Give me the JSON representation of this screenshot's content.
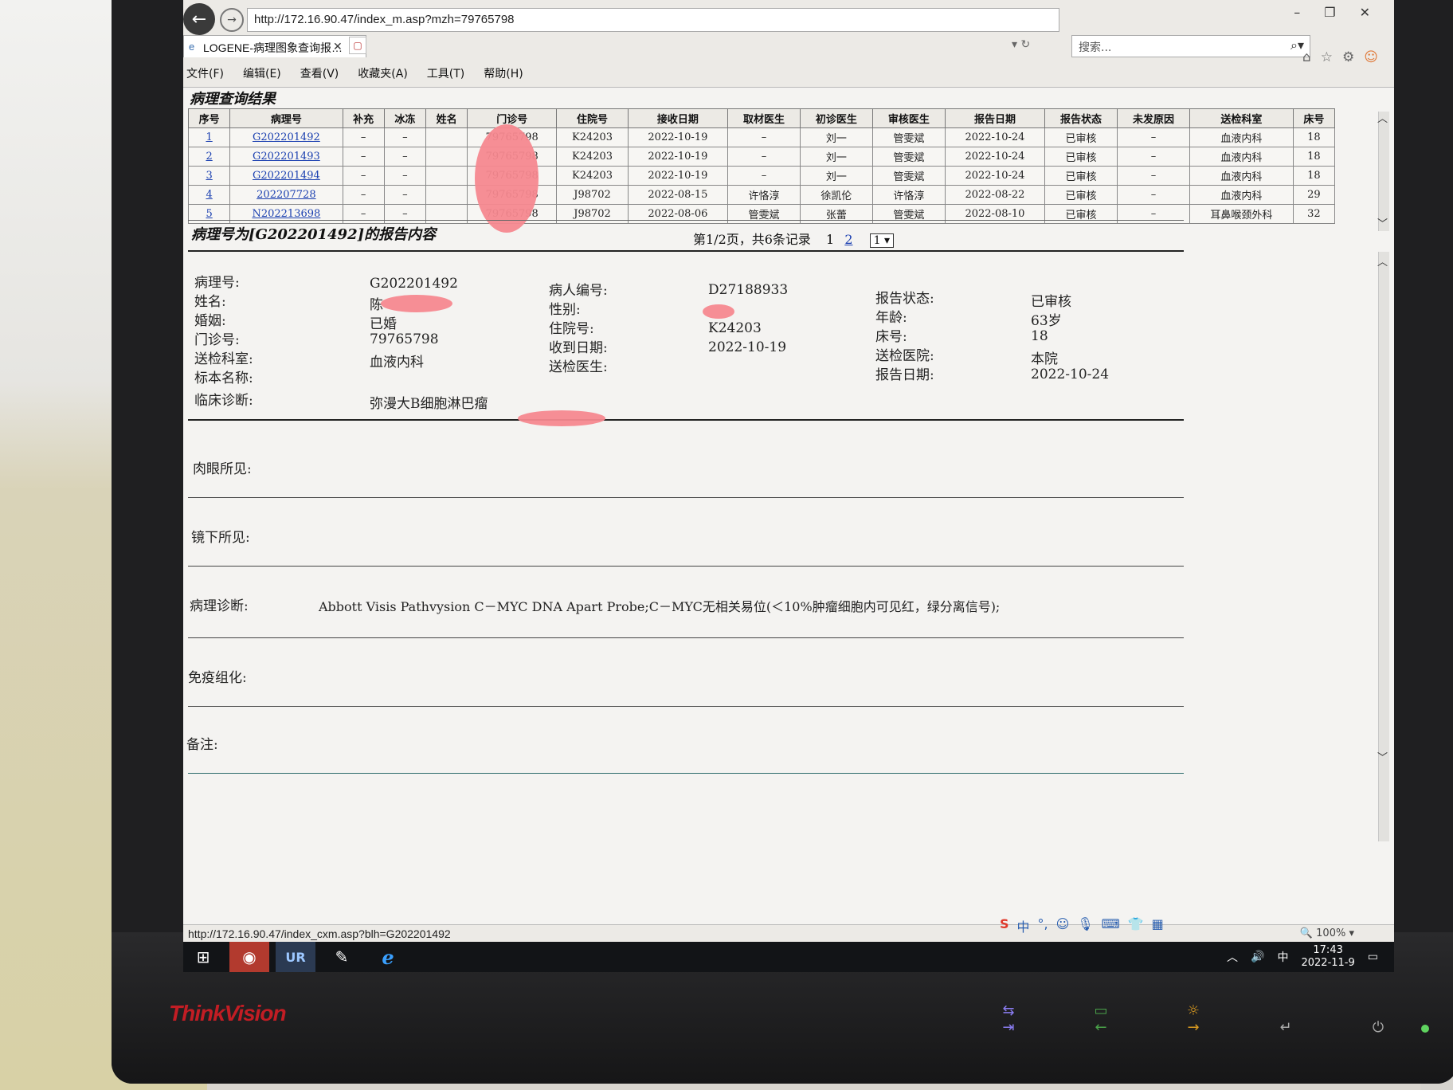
{
  "browser": {
    "url": "http://172.16.90.47/index_m.asp?mzh=79765798",
    "tab_title": "LOGENE-病理图象查询报…",
    "search_placeholder": "搜索...",
    "menu": [
      "文件(F)",
      "编辑(E)",
      "查看(V)",
      "收藏夹(A)",
      "工具(T)",
      "帮助(H)"
    ],
    "status_url": "http://172.16.90.47/index_cxm.asp?blh=G202201492",
    "zoom": "100%"
  },
  "results": {
    "title": "病理查询结果",
    "headers": [
      "序号",
      "病理号",
      "补充",
      "冰冻",
      "姓名",
      "门诊号",
      "住院号",
      "接收日期",
      "取材医生",
      "初诊医生",
      "审核医生",
      "报告日期",
      "报告状态",
      "未发原因",
      "送检科室",
      "床号"
    ],
    "rows": [
      [
        "1",
        "G202201492",
        "–",
        "–",
        "",
        "79765798",
        "K24203",
        "2022-10-19",
        "–",
        "刘一",
        "管雯斌",
        "2022-10-24",
        "已审核",
        "–",
        "血液内科",
        "18"
      ],
      [
        "2",
        "G202201493",
        "–",
        "–",
        "",
        "79765798",
        "K24203",
        "2022-10-19",
        "–",
        "刘一",
        "管雯斌",
        "2022-10-24",
        "已审核",
        "–",
        "血液内科",
        "18"
      ],
      [
        "3",
        "G202201494",
        "–",
        "–",
        "",
        "79765798",
        "K24203",
        "2022-10-19",
        "–",
        "刘一",
        "管雯斌",
        "2022-10-24",
        "已审核",
        "–",
        "血液内科",
        "18"
      ],
      [
        "4",
        "202207728",
        "–",
        "–",
        "",
        "79765798",
        "J98702",
        "2022-08-15",
        "许恪淳",
        "徐凯伦",
        "许恪淳",
        "2022-08-22",
        "已审核",
        "–",
        "血液内科",
        "29"
      ],
      [
        "5",
        "N202213698",
        "–",
        "–",
        "",
        "79765798",
        "J98702",
        "2022-08-06",
        "管雯斌",
        "张蕾",
        "管雯斌",
        "2022-08-10",
        "已审核",
        "–",
        "耳鼻喉颈外科",
        "32"
      ]
    ],
    "pager_text": "第1/2页，共6条记录",
    "page_current": "1",
    "page_next": "2",
    "page_select": "1"
  },
  "report": {
    "title": "病理号为[G202201492]的报告内容",
    "fields": {
      "blh_label": "病理号:",
      "blh_value": "G202201492",
      "name_label": "姓名:",
      "name_value": "陈",
      "marital_label": "婚姻:",
      "marital_value": "已婚",
      "outpatient_label": "门诊号:",
      "outpatient_value": "79765798",
      "dept_label": "送检科室:",
      "dept_value": "血液内科",
      "specimen_label": "标本名称:",
      "specimen_value": "",
      "clinical_label": "临床诊断:",
      "clinical_value": "弥漫大B细胞淋巴瘤",
      "patient_id_label": "病人编号:",
      "patient_id_value": "D27188933",
      "sex_label": "性别:",
      "sex_value": "",
      "inpatient_label": "住院号:",
      "inpatient_value": "K24203",
      "received_label": "收到日期:",
      "received_value": "2022-10-19",
      "doctor_label": "送检医生:",
      "doctor_value": "",
      "status_label": "报告状态:",
      "status_value": "已审核",
      "age_label": "年龄:",
      "age_value": "63岁",
      "bed_label": "床号:",
      "bed_value": "18",
      "hospital_label": "送检医院:",
      "hospital_value": "本院",
      "report_date_label": "报告日期:",
      "report_date_value": "2022-10-24"
    },
    "gross_label": "肉眼所见:",
    "micro_label": "镜下所见:",
    "diagnosis_label": "病理诊断:",
    "diagnosis_value": "Abbott Visis Pathvysion C－MYC DNA Apart Probe;C－MYC无相关易位(＜10%肿瘤细胞内可见红，绿分离信号);",
    "ihc_label": "免疫组化:",
    "remark_label": "备注:"
  },
  "taskbar": {
    "time": "17:43",
    "date": "2022-11-9",
    "ime_lang": "中"
  },
  "monitor": {
    "brand": "ThinkVision"
  }
}
